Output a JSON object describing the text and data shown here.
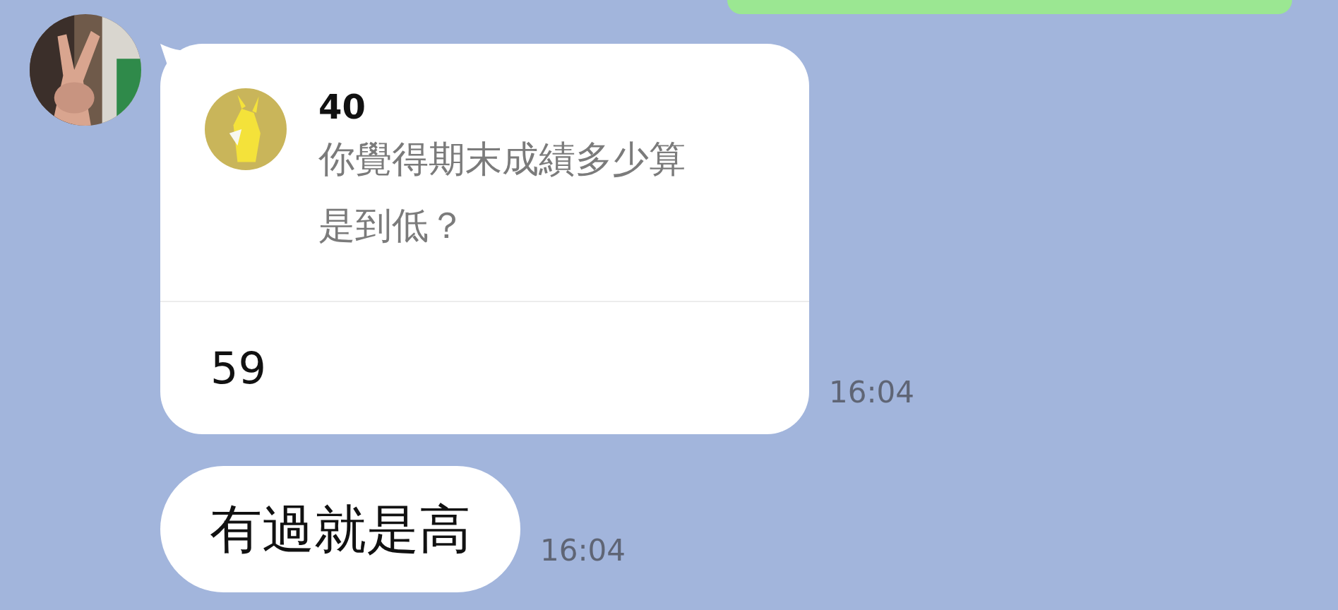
{
  "messages": [
    {
      "kind": "outgoing"
    },
    {
      "kind": "reply",
      "quote": {
        "sender": "40",
        "text": "你覺得期末成績多少算是到低？"
      },
      "text": "59",
      "time": "16:04"
    },
    {
      "kind": "text",
      "text": "有過就是高",
      "time": "16:04"
    }
  ]
}
